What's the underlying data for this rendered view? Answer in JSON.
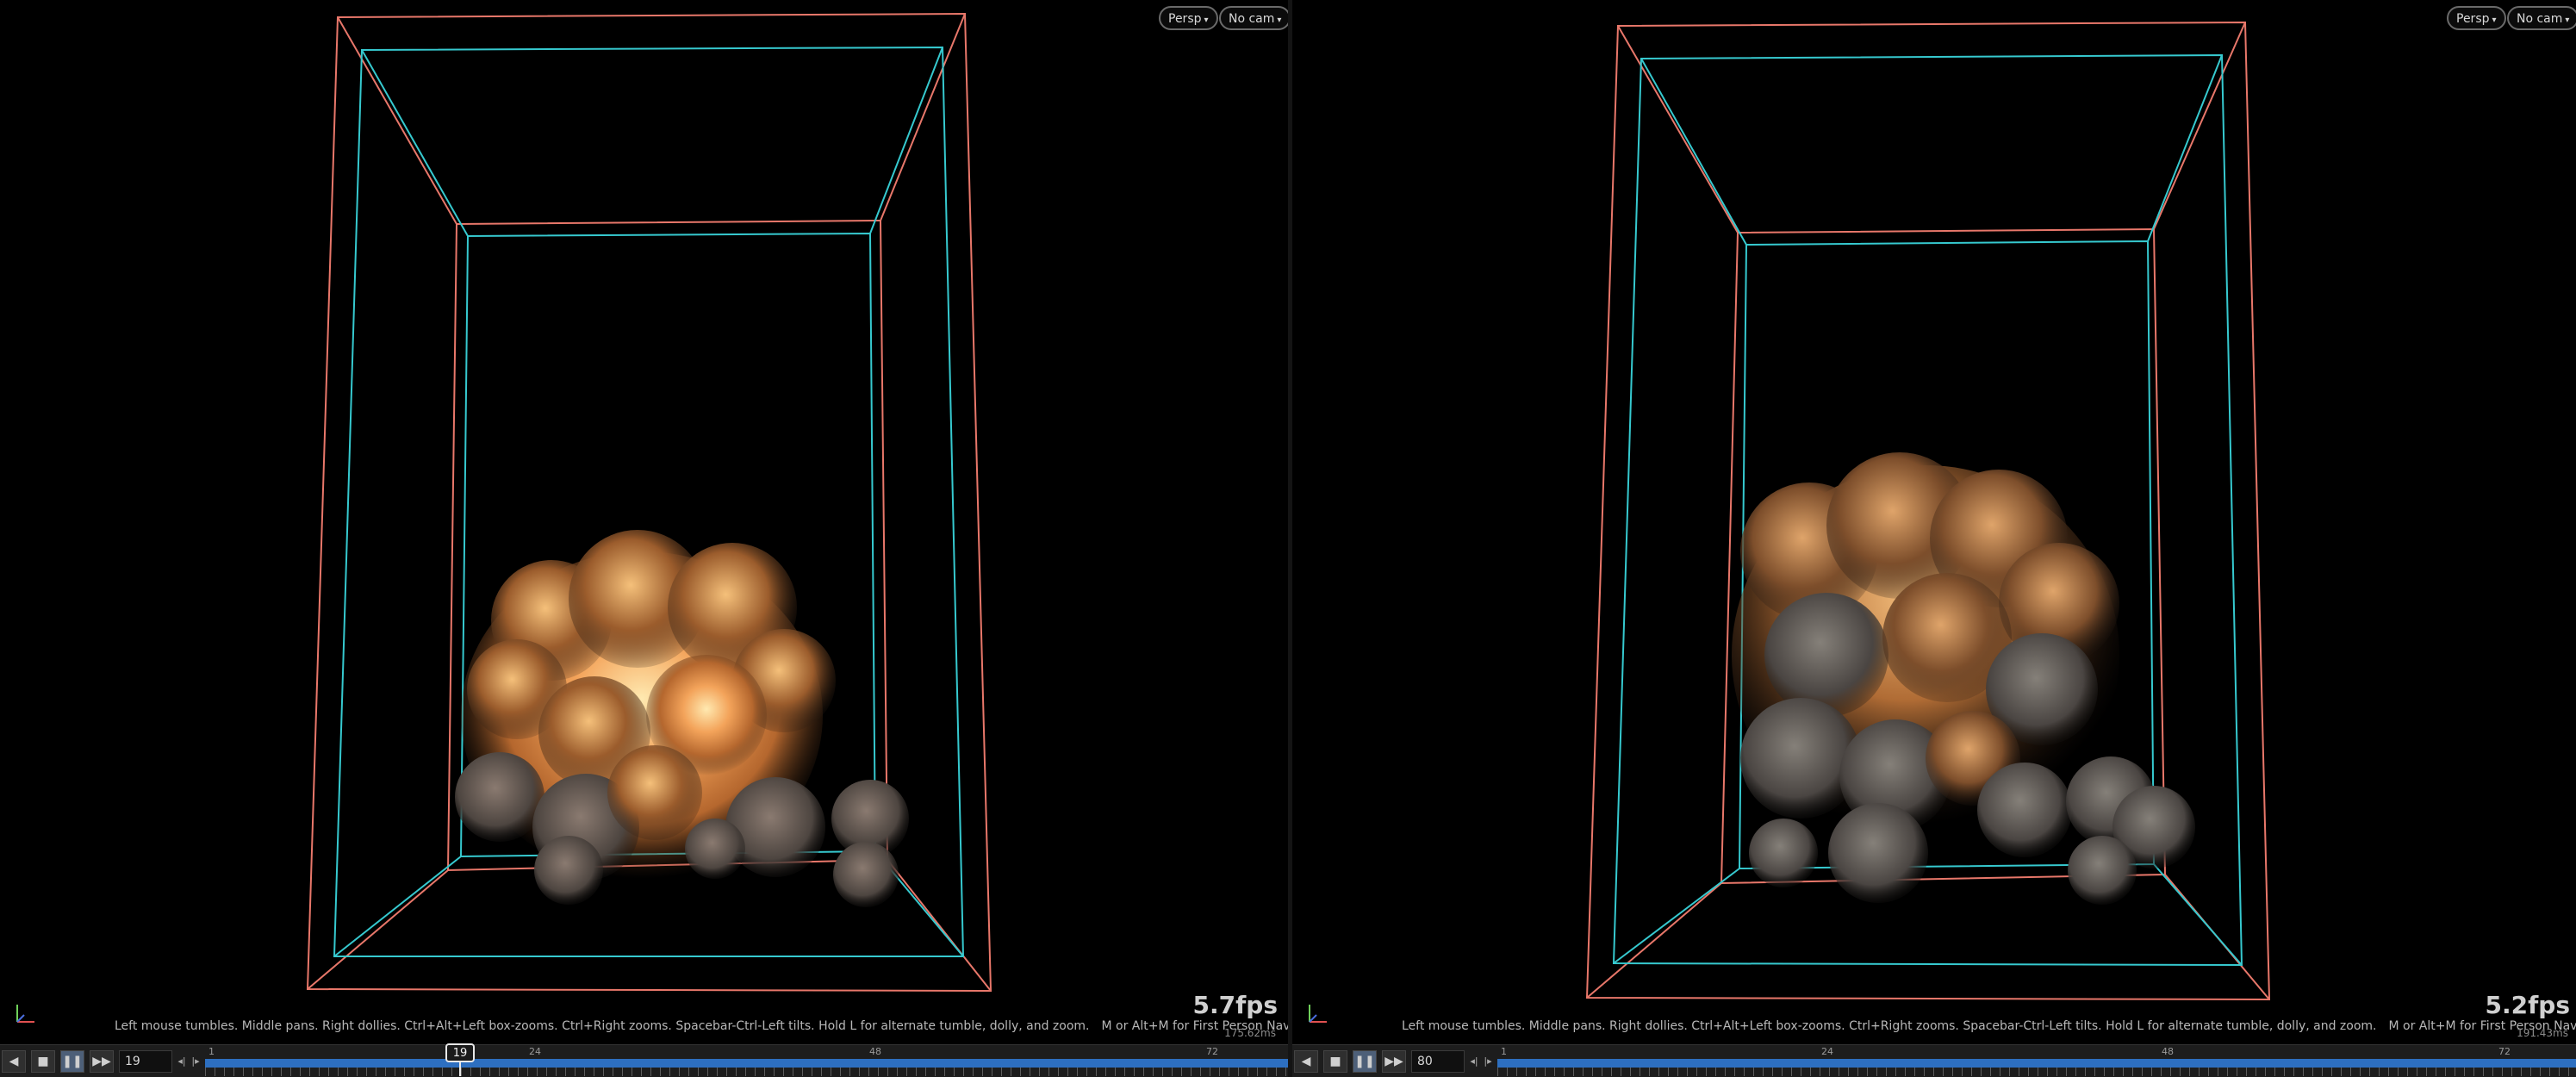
{
  "colors": {
    "outer_box": "#e8776a",
    "inner_box": "#36c9cf",
    "track": "#2d6fc0"
  },
  "viewports": [
    {
      "persp_label": "Persp",
      "cam_label": "No cam",
      "fps": "5.7fps",
      "ms": "175.62ms",
      "hint": "Left mouse tumbles. Middle pans. Right dollies. Ctrl+Alt+Left box-zooms. Ctrl+Right zooms. Spacebar-Ctrl-Left tilts. Hold L for alternate tumble, dolly, and zoom.",
      "hint_extra": "M or Alt+M for First Person Navigation.",
      "frame": "19",
      "cursor_label": "19",
      "ticks": [
        "1",
        "24",
        "48",
        "72"
      ]
    },
    {
      "persp_label": "Persp",
      "cam_label": "No cam",
      "fps": "5.2fps",
      "ms": "191.43ms",
      "hint": "Left mouse tumbles. Middle pans. Right dollies. Ctrl+Alt+Left box-zooms. Ctrl+Right zooms. Spacebar-Ctrl-Left tilts. Hold L for alternate tumble, dolly, and zoom.",
      "hint_extra": "M or Alt+M for First Person Navigation.",
      "frame": "80",
      "ticks": [
        "1",
        "24",
        "48",
        "72"
      ]
    }
  ],
  "icons": {
    "play_reverse": "play-reverse-icon",
    "stop": "stop-icon",
    "pause": "pause-icon",
    "jump_end": "jump-end-icon"
  }
}
